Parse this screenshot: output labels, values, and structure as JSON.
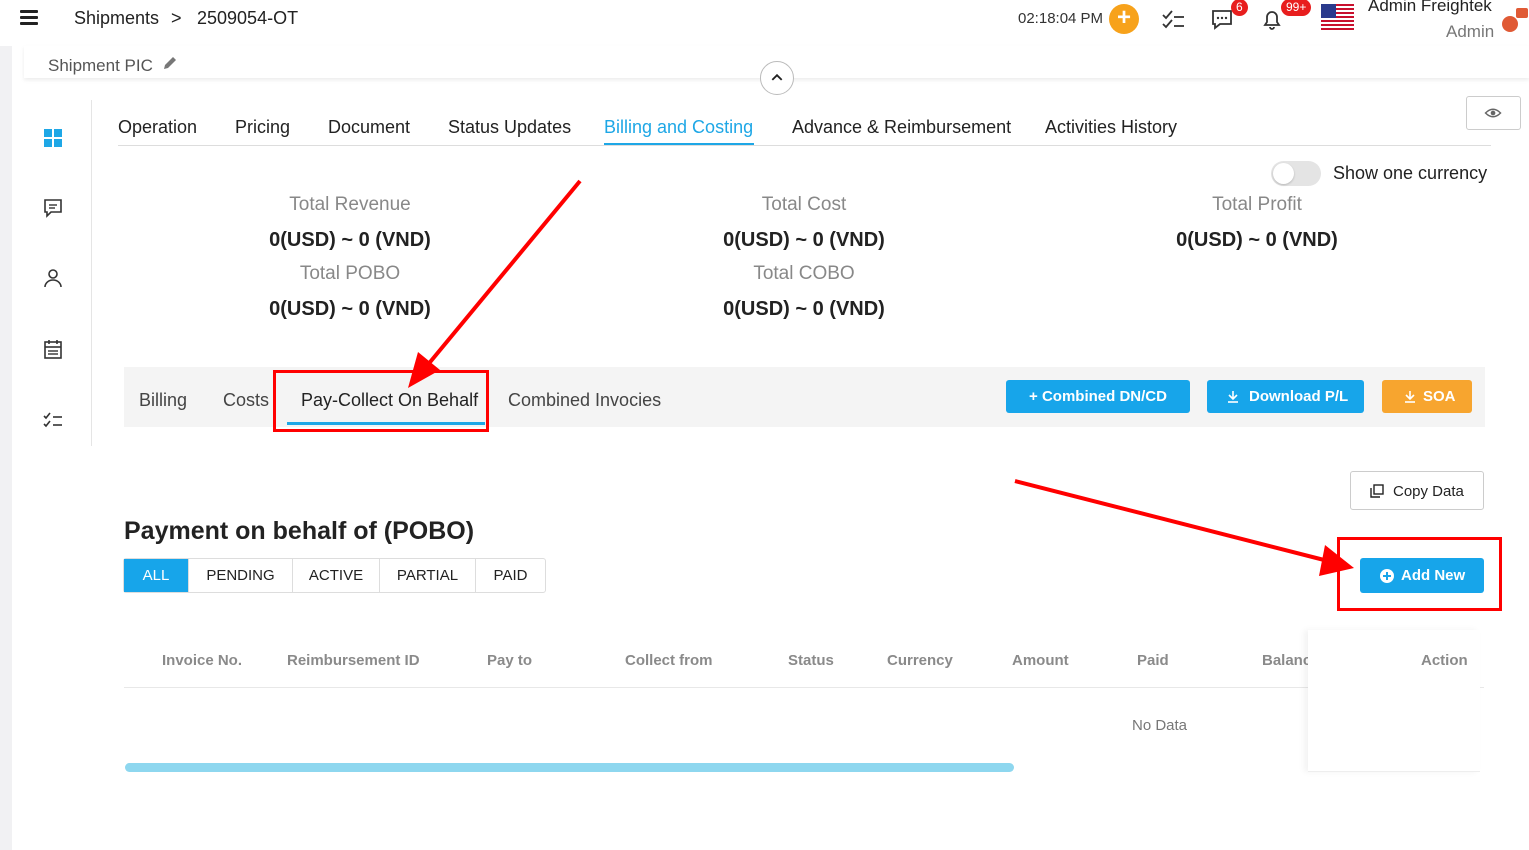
{
  "header": {
    "breadcrumb": [
      "Shipments",
      ">",
      "2509054-OT"
    ],
    "time": "02:18:04 PM",
    "chat_badge": "6",
    "notif_badge": "99+",
    "user_name": "Admin Freightek",
    "user_role": "Admin"
  },
  "shipment_pic_label": "Shipment PIC",
  "tabs": [
    "Operation",
    "Pricing",
    "Document",
    "Status Updates",
    "Billing and Costing",
    "Advance & Reimbursement",
    "Activities History"
  ],
  "active_tab": "Billing and Costing",
  "show_one_currency": "Show one currency",
  "summary": {
    "total_revenue": {
      "label": "Total Revenue",
      "value": "0(USD) ~ 0 (VND)"
    },
    "total_cost": {
      "label": "Total Cost",
      "value": "0(USD) ~ 0 (VND)"
    },
    "total_profit": {
      "label": "Total Profit",
      "value": "0(USD) ~ 0 (VND)"
    },
    "total_pobo": {
      "label": "Total POBO",
      "value": "0(USD) ~ 0 (VND)"
    },
    "total_cobo": {
      "label": "Total COBO",
      "value": "0(USD) ~ 0 (VND)"
    }
  },
  "subtabs": [
    "Billing",
    "Costs",
    "Pay-Collect On Behalf",
    "Combined Invocies"
  ],
  "active_subtab": "Pay-Collect On Behalf",
  "actions": {
    "combined": "+ Combined DN/CD",
    "download": "Download P/L",
    "soa": "SOA",
    "copy_data": "Copy Data",
    "add_new": "Add New"
  },
  "section_title": "Payment on behalf of (POBO)",
  "filters": [
    "ALL",
    "PENDING",
    "ACTIVE",
    "PARTIAL",
    "PAID"
  ],
  "active_filter": "ALL",
  "table": {
    "columns": [
      "Invoice No.",
      "Reimbursement ID",
      "Pay to",
      "Collect from",
      "Status",
      "Currency",
      "Amount",
      "Paid",
      "Balanc",
      "Action"
    ],
    "empty_text": "No Data"
  },
  "colors": {
    "accent": "#1ea7e6",
    "orange": "#f7a52f",
    "annotation": "#ff0000"
  }
}
